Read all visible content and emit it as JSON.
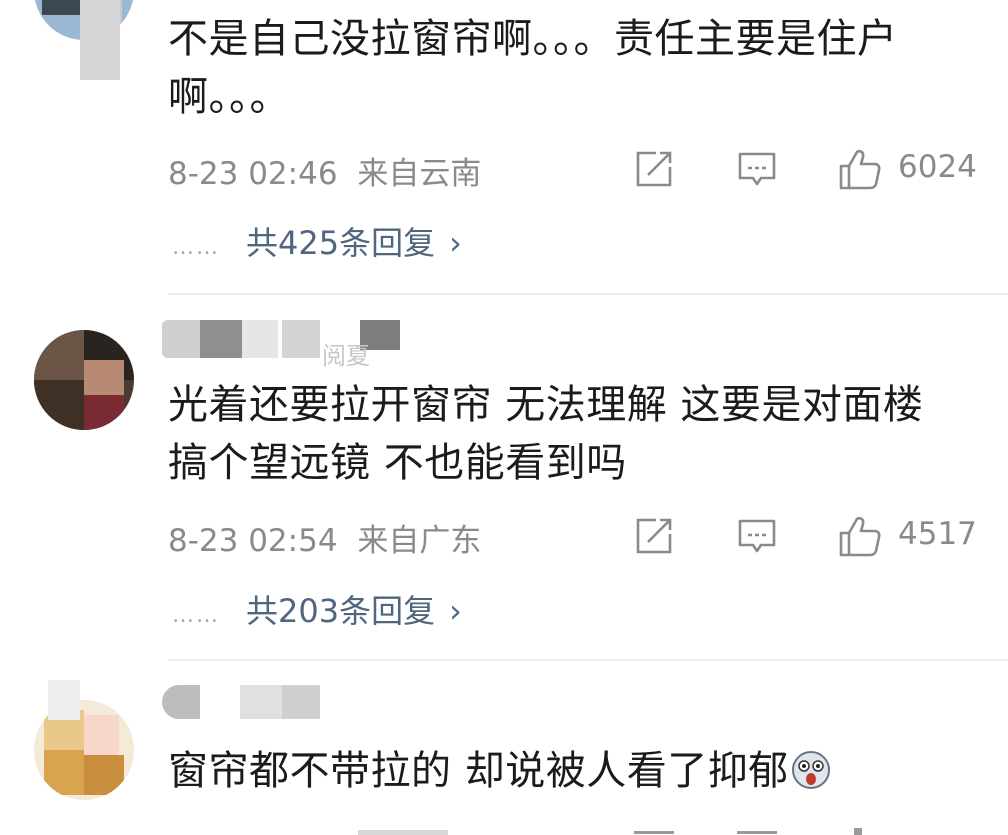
{
  "comments": [
    {
      "text": "不是自己没拉窗帘啊。。。责任主要是住户啊。。。",
      "timestamp": "8-23 02:46",
      "location": "来自云南",
      "likes": "6024",
      "replies": "共425条回复",
      "reply_dots": "……",
      "reply_chevron": "›"
    },
    {
      "username_partial": "阅夏",
      "text": "光着还要拉开窗帘  无法理解  这要是对面楼搞个望远镜  不也能看到吗",
      "timestamp": "8-23 02:54",
      "location": "来自广东",
      "likes": "4517",
      "replies": "共203条回复",
      "reply_dots": "……",
      "reply_chevron": "›"
    },
    {
      "text": "窗帘都不带拉的 却说被人看了抑郁",
      "emoji": "scared-face-emoji"
    }
  ],
  "icons": {
    "share": "share-icon",
    "comment": "comment-icon",
    "like": "thumbs-up-icon"
  },
  "colors": {
    "text": "#1b1b1b",
    "meta": "#8a8a8a",
    "reply_link": "#506580",
    "divider": "#ededed"
  }
}
